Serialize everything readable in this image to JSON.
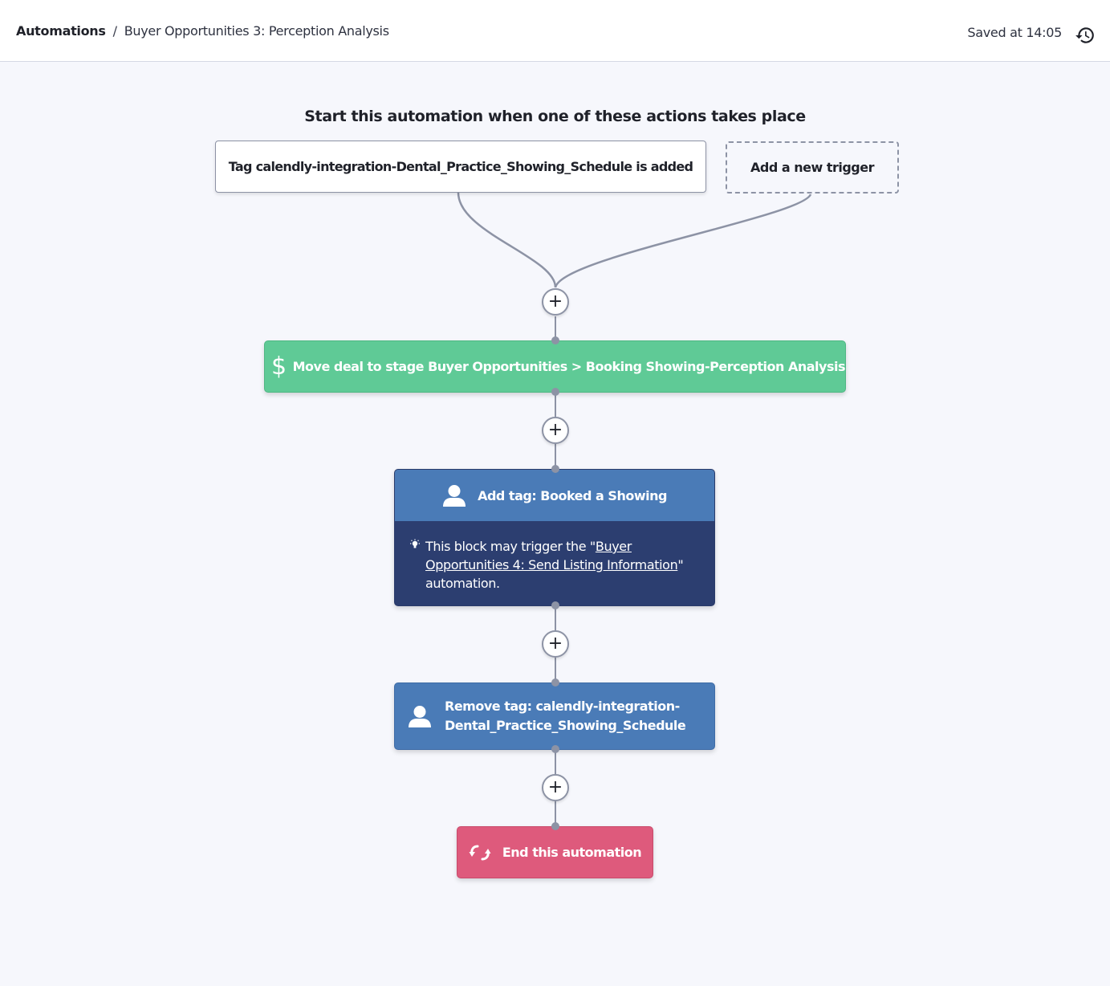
{
  "header": {
    "breadcrumb_root": "Automations",
    "breadcrumb_separator": "/",
    "breadcrumb_current": "Buyer Opportunities 3: Perception Analysis",
    "saved_status": "Saved at 14:05",
    "history_icon": "history-icon"
  },
  "canvas": {
    "start_title": "Start this automation when one of these actions takes place",
    "triggers": [
      {
        "label": "Tag calendly-integration-Dental_Practice_Showing_Schedule is added"
      }
    ],
    "add_trigger_label": "Add a new trigger",
    "add_step_symbol": "+",
    "steps": [
      {
        "type": "deal",
        "icon": "dollar-icon",
        "icon_glyph": "$",
        "label": "Move deal to stage Buyer Opportunities > Booking Showing-Perception Analysis",
        "color": "#5fca96"
      },
      {
        "type": "add-tag",
        "icon": "contact-icon",
        "label": "Add tag: Booked a Showing",
        "color": "#4a7bb7",
        "note": {
          "icon": "lightbulb-icon",
          "prefix": "This block may trigger the \"",
          "link": "Buyer Opportunities 4: Send Listing Information",
          "suffix": "\" automation.",
          "color": "#2c3e70"
        }
      },
      {
        "type": "remove-tag",
        "icon": "contact-icon",
        "label": "Remove tag: calendly-integration-Dental_Practice_Showing_Schedule",
        "color": "#4a7bb7"
      },
      {
        "type": "end",
        "icon": "end-loop-icon",
        "label": "End this automation",
        "color": "#de5a7c"
      }
    ]
  }
}
